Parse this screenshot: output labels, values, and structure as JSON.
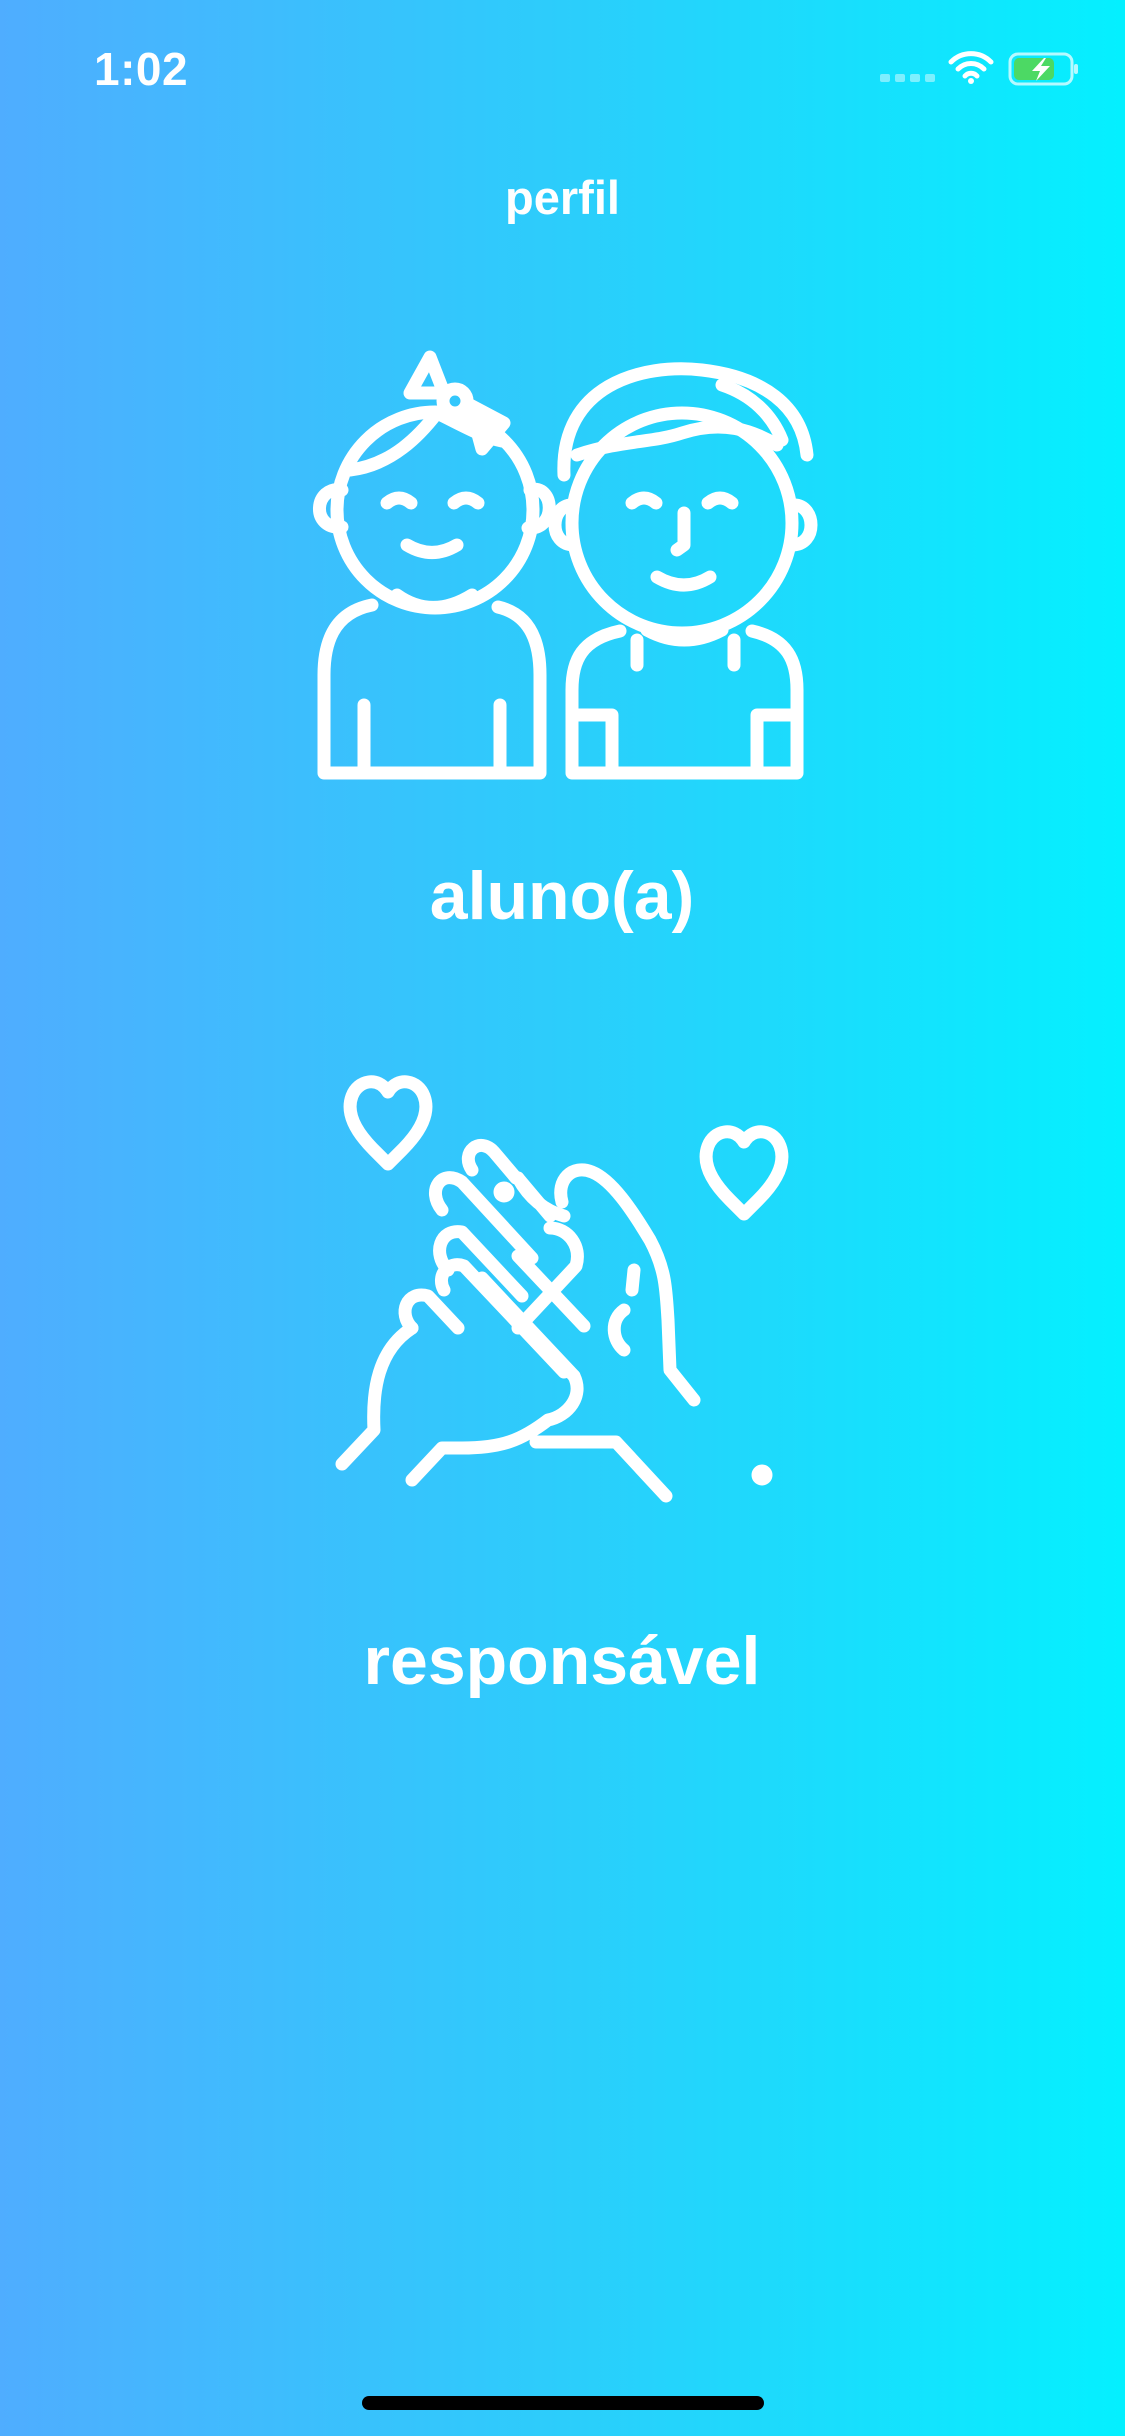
{
  "status_bar": {
    "time": "1:02",
    "icons": [
      "cellular-signal-icon",
      "wifi-icon",
      "battery-charging-icon"
    ]
  },
  "page": {
    "title": "perfil"
  },
  "options": [
    {
      "label": "aluno(a)",
      "icon": "children-icon"
    },
    {
      "label": "responsável",
      "icon": "caring-hands-icon"
    }
  ],
  "colors": {
    "gradient_start": "#4fadff",
    "gradient_end": "#04f0ff",
    "foreground": "#ffffff",
    "battery_fill": "#4cd964"
  }
}
